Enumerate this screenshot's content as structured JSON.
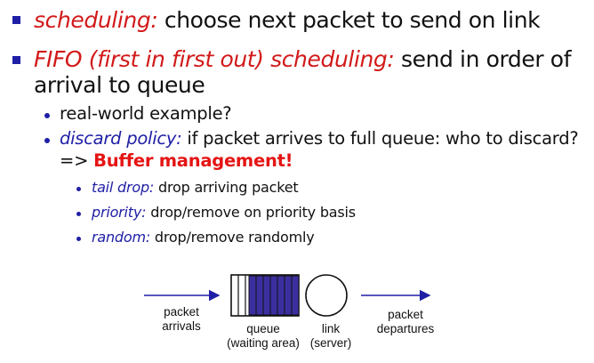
{
  "bullets": {
    "b1": {
      "term": "scheduling:",
      "text": " choose next packet to send on link"
    },
    "b2": {
      "term": "FIFO (first in first out) scheduling:",
      "text": " send in order of",
      "cont": "arrival to queue"
    },
    "b3": {
      "text": "real-world example?"
    },
    "b4": {
      "term": "discard policy:",
      "text": " if packet arrives to full queue: who to discard?",
      "prefix": "=> ",
      "emph": "Buffer management!"
    },
    "b5": {
      "term": "tail drop:",
      "text": " drop arriving packet"
    },
    "b6": {
      "term": "priority:",
      "text": " drop/remove on priority basis"
    },
    "b7": {
      "term": "random:",
      "text": " drop/remove randomly"
    }
  },
  "diagram": {
    "arrivals": [
      "packet",
      "arrivals"
    ],
    "queue": [
      "queue",
      "(waiting area)"
    ],
    "link": [
      "link",
      "(server)"
    ],
    "departures": [
      "packet",
      "departures"
    ],
    "fill_color": "#3b2fa0"
  }
}
